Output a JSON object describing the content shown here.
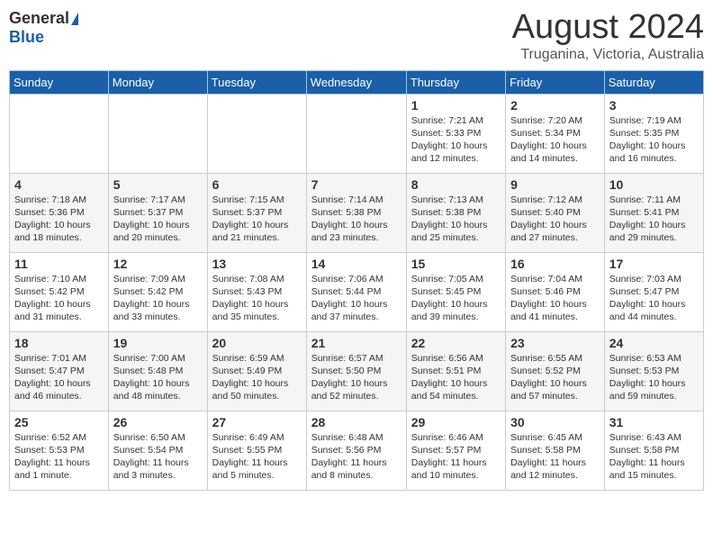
{
  "header": {
    "logo_general": "General",
    "logo_blue": "Blue",
    "month_title": "August 2024",
    "location": "Truganina, Victoria, Australia"
  },
  "calendar": {
    "days_of_week": [
      "Sunday",
      "Monday",
      "Tuesday",
      "Wednesday",
      "Thursday",
      "Friday",
      "Saturday"
    ],
    "weeks": [
      {
        "days": [
          {
            "num": "",
            "detail": ""
          },
          {
            "num": "",
            "detail": ""
          },
          {
            "num": "",
            "detail": ""
          },
          {
            "num": "",
            "detail": ""
          },
          {
            "num": "1",
            "detail": "Sunrise: 7:21 AM\nSunset: 5:33 PM\nDaylight: 10 hours\nand 12 minutes."
          },
          {
            "num": "2",
            "detail": "Sunrise: 7:20 AM\nSunset: 5:34 PM\nDaylight: 10 hours\nand 14 minutes."
          },
          {
            "num": "3",
            "detail": "Sunrise: 7:19 AM\nSunset: 5:35 PM\nDaylight: 10 hours\nand 16 minutes."
          }
        ]
      },
      {
        "days": [
          {
            "num": "4",
            "detail": "Sunrise: 7:18 AM\nSunset: 5:36 PM\nDaylight: 10 hours\nand 18 minutes."
          },
          {
            "num": "5",
            "detail": "Sunrise: 7:17 AM\nSunset: 5:37 PM\nDaylight: 10 hours\nand 20 minutes."
          },
          {
            "num": "6",
            "detail": "Sunrise: 7:15 AM\nSunset: 5:37 PM\nDaylight: 10 hours\nand 21 minutes."
          },
          {
            "num": "7",
            "detail": "Sunrise: 7:14 AM\nSunset: 5:38 PM\nDaylight: 10 hours\nand 23 minutes."
          },
          {
            "num": "8",
            "detail": "Sunrise: 7:13 AM\nSunset: 5:38 PM\nDaylight: 10 hours\nand 25 minutes."
          },
          {
            "num": "9",
            "detail": "Sunrise: 7:12 AM\nSunset: 5:40 PM\nDaylight: 10 hours\nand 27 minutes."
          },
          {
            "num": "10",
            "detail": "Sunrise: 7:11 AM\nSunset: 5:41 PM\nDaylight: 10 hours\nand 29 minutes."
          }
        ]
      },
      {
        "days": [
          {
            "num": "11",
            "detail": "Sunrise: 7:10 AM\nSunset: 5:42 PM\nDaylight: 10 hours\nand 31 minutes."
          },
          {
            "num": "12",
            "detail": "Sunrise: 7:09 AM\nSunset: 5:42 PM\nDaylight: 10 hours\nand 33 minutes."
          },
          {
            "num": "13",
            "detail": "Sunrise: 7:08 AM\nSunset: 5:43 PM\nDaylight: 10 hours\nand 35 minutes."
          },
          {
            "num": "14",
            "detail": "Sunrise: 7:06 AM\nSunset: 5:44 PM\nDaylight: 10 hours\nand 37 minutes."
          },
          {
            "num": "15",
            "detail": "Sunrise: 7:05 AM\nSunset: 5:45 PM\nDaylight: 10 hours\nand 39 minutes."
          },
          {
            "num": "16",
            "detail": "Sunrise: 7:04 AM\nSunset: 5:46 PM\nDaylight: 10 hours\nand 41 minutes."
          },
          {
            "num": "17",
            "detail": "Sunrise: 7:03 AM\nSunset: 5:47 PM\nDaylight: 10 hours\nand 44 minutes."
          }
        ]
      },
      {
        "days": [
          {
            "num": "18",
            "detail": "Sunrise: 7:01 AM\nSunset: 5:47 PM\nDaylight: 10 hours\nand 46 minutes."
          },
          {
            "num": "19",
            "detail": "Sunrise: 7:00 AM\nSunset: 5:48 PM\nDaylight: 10 hours\nand 48 minutes."
          },
          {
            "num": "20",
            "detail": "Sunrise: 6:59 AM\nSunset: 5:49 PM\nDaylight: 10 hours\nand 50 minutes."
          },
          {
            "num": "21",
            "detail": "Sunrise: 6:57 AM\nSunset: 5:50 PM\nDaylight: 10 hours\nand 52 minutes."
          },
          {
            "num": "22",
            "detail": "Sunrise: 6:56 AM\nSunset: 5:51 PM\nDaylight: 10 hours\nand 54 minutes."
          },
          {
            "num": "23",
            "detail": "Sunrise: 6:55 AM\nSunset: 5:52 PM\nDaylight: 10 hours\nand 57 minutes."
          },
          {
            "num": "24",
            "detail": "Sunrise: 6:53 AM\nSunset: 5:53 PM\nDaylight: 10 hours\nand 59 minutes."
          }
        ]
      },
      {
        "days": [
          {
            "num": "25",
            "detail": "Sunrise: 6:52 AM\nSunset: 5:53 PM\nDaylight: 11 hours\nand 1 minute."
          },
          {
            "num": "26",
            "detail": "Sunrise: 6:50 AM\nSunset: 5:54 PM\nDaylight: 11 hours\nand 3 minutes."
          },
          {
            "num": "27",
            "detail": "Sunrise: 6:49 AM\nSunset: 5:55 PM\nDaylight: 11 hours\nand 5 minutes."
          },
          {
            "num": "28",
            "detail": "Sunrise: 6:48 AM\nSunset: 5:56 PM\nDaylight: 11 hours\nand 8 minutes."
          },
          {
            "num": "29",
            "detail": "Sunrise: 6:46 AM\nSunset: 5:57 PM\nDaylight: 11 hours\nand 10 minutes."
          },
          {
            "num": "30",
            "detail": "Sunrise: 6:45 AM\nSunset: 5:58 PM\nDaylight: 11 hours\nand 12 minutes."
          },
          {
            "num": "31",
            "detail": "Sunrise: 6:43 AM\nSunset: 5:58 PM\nDaylight: 11 hours\nand 15 minutes."
          }
        ]
      }
    ]
  }
}
